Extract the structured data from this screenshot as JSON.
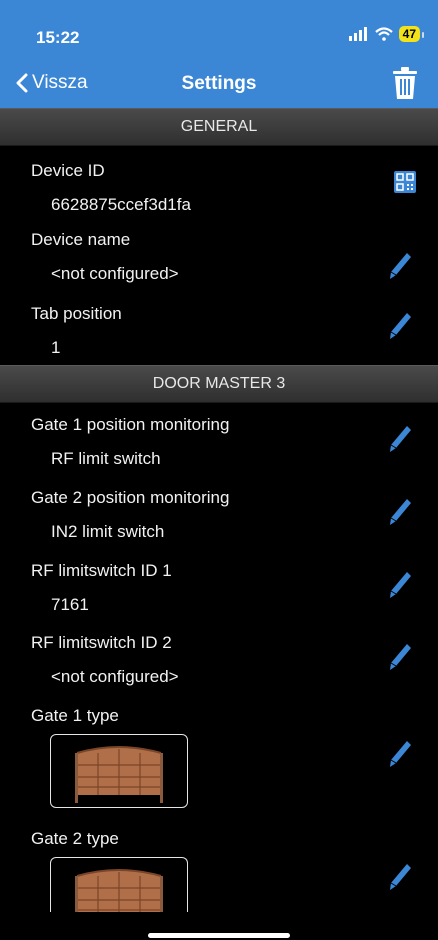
{
  "status": {
    "time": "15:22",
    "battery": "47"
  },
  "nav": {
    "back_label": "Vissza",
    "title": "Settings"
  },
  "sections": {
    "general": "GENERAL",
    "door_master": "DOOR MASTER 3"
  },
  "general": {
    "device_id": {
      "label": "Device ID",
      "value": "6628875ccef3d1fa"
    },
    "device_name": {
      "label": "Device name",
      "value": "<not configured>"
    },
    "tab_position": {
      "label": "Tab position",
      "value": "1"
    }
  },
  "door": {
    "gate1_monitoring": {
      "label": "Gate 1 position monitoring",
      "value": "RF limit switch"
    },
    "gate2_monitoring": {
      "label": "Gate 2 position monitoring",
      "value": "IN2 limit switch"
    },
    "rf_id1": {
      "label": "RF limitswitch ID 1",
      "value": "7161"
    },
    "rf_id2": {
      "label": "RF limitswitch ID 2",
      "value": "<not configured>"
    },
    "gate1_type": {
      "label": "Gate 1 type"
    },
    "gate2_type": {
      "label": "Gate 2 type"
    }
  },
  "colors": {
    "accent": "#3b87d6",
    "edit_icon": "#3b87d6",
    "background": "#000000"
  },
  "icons": {
    "back": "chevron-left-icon",
    "delete": "trash-icon",
    "edit": "pencil-icon",
    "qr": "qr-code-icon",
    "gate": "garage-door-icon"
  }
}
